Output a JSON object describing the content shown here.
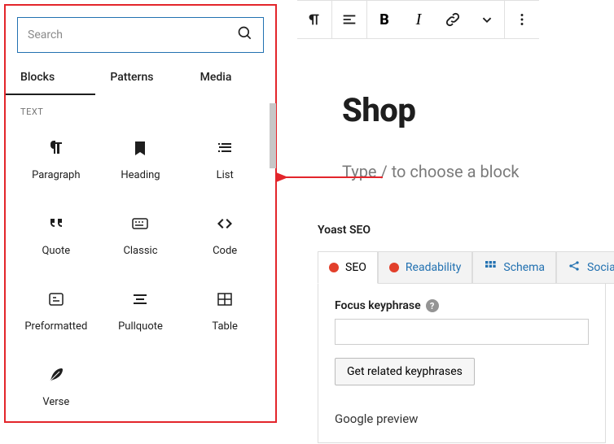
{
  "inserter": {
    "search_placeholder": "Search",
    "tabs": [
      "Blocks",
      "Patterns",
      "Media"
    ],
    "active_tab": 0,
    "category": "TEXT",
    "blocks": [
      {
        "id": "paragraph",
        "label": "Paragraph"
      },
      {
        "id": "heading",
        "label": "Heading"
      },
      {
        "id": "list",
        "label": "List"
      },
      {
        "id": "quote",
        "label": "Quote"
      },
      {
        "id": "classic",
        "label": "Classic"
      },
      {
        "id": "code",
        "label": "Code"
      },
      {
        "id": "preformatted",
        "label": "Preformatted"
      },
      {
        "id": "pullquote",
        "label": "Pullquote"
      },
      {
        "id": "table",
        "label": "Table"
      },
      {
        "id": "verse",
        "label": "Verse"
      }
    ]
  },
  "toolbar": {
    "items": [
      "paragraph",
      "align",
      "bold",
      "italic",
      "link",
      "chevron",
      "more"
    ]
  },
  "editor": {
    "title": "Shop",
    "placeholder": "Type / to choose a block"
  },
  "yoast": {
    "label": "Yoast SEO",
    "tabs": [
      {
        "label": "SEO",
        "color": "#e23f2b",
        "active": true
      },
      {
        "label": "Readability",
        "color": "#e23f2b"
      },
      {
        "label": "Schema"
      },
      {
        "label": "Social"
      }
    ],
    "focus_label": "Focus keyphrase",
    "button": "Get related keyphrases",
    "google_preview": "Google preview"
  }
}
